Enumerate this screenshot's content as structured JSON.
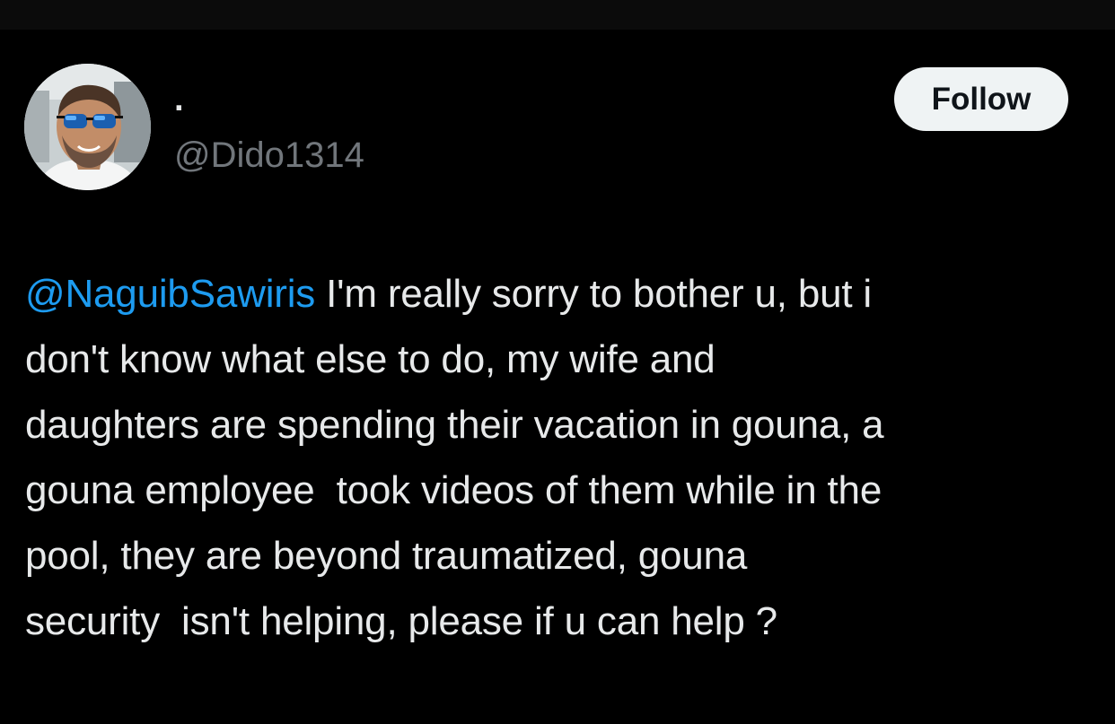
{
  "author": {
    "display_name": "·",
    "handle": "@Dido1314",
    "avatar_icon": "profile-photo-man-sunglasses"
  },
  "actions": {
    "follow_label": "Follow"
  },
  "tweet": {
    "mention": "@NaguibSawiris",
    "body": " I'm really sorry to bother u, but i\ndon't know what else to do, my wife and\ndaughters are spending their vacation in gouna, a\ngouna employee  took videos of them while in the\npool, they are beyond traumatized, gouna\nsecurity  isn't helping, please if u can help ?"
  },
  "colors": {
    "background": "#000000",
    "text": "#e7e9ea",
    "secondary_text": "#71767b",
    "link": "#1d9bf0",
    "button_bg": "#eff3f4",
    "button_text": "#0f1419"
  }
}
